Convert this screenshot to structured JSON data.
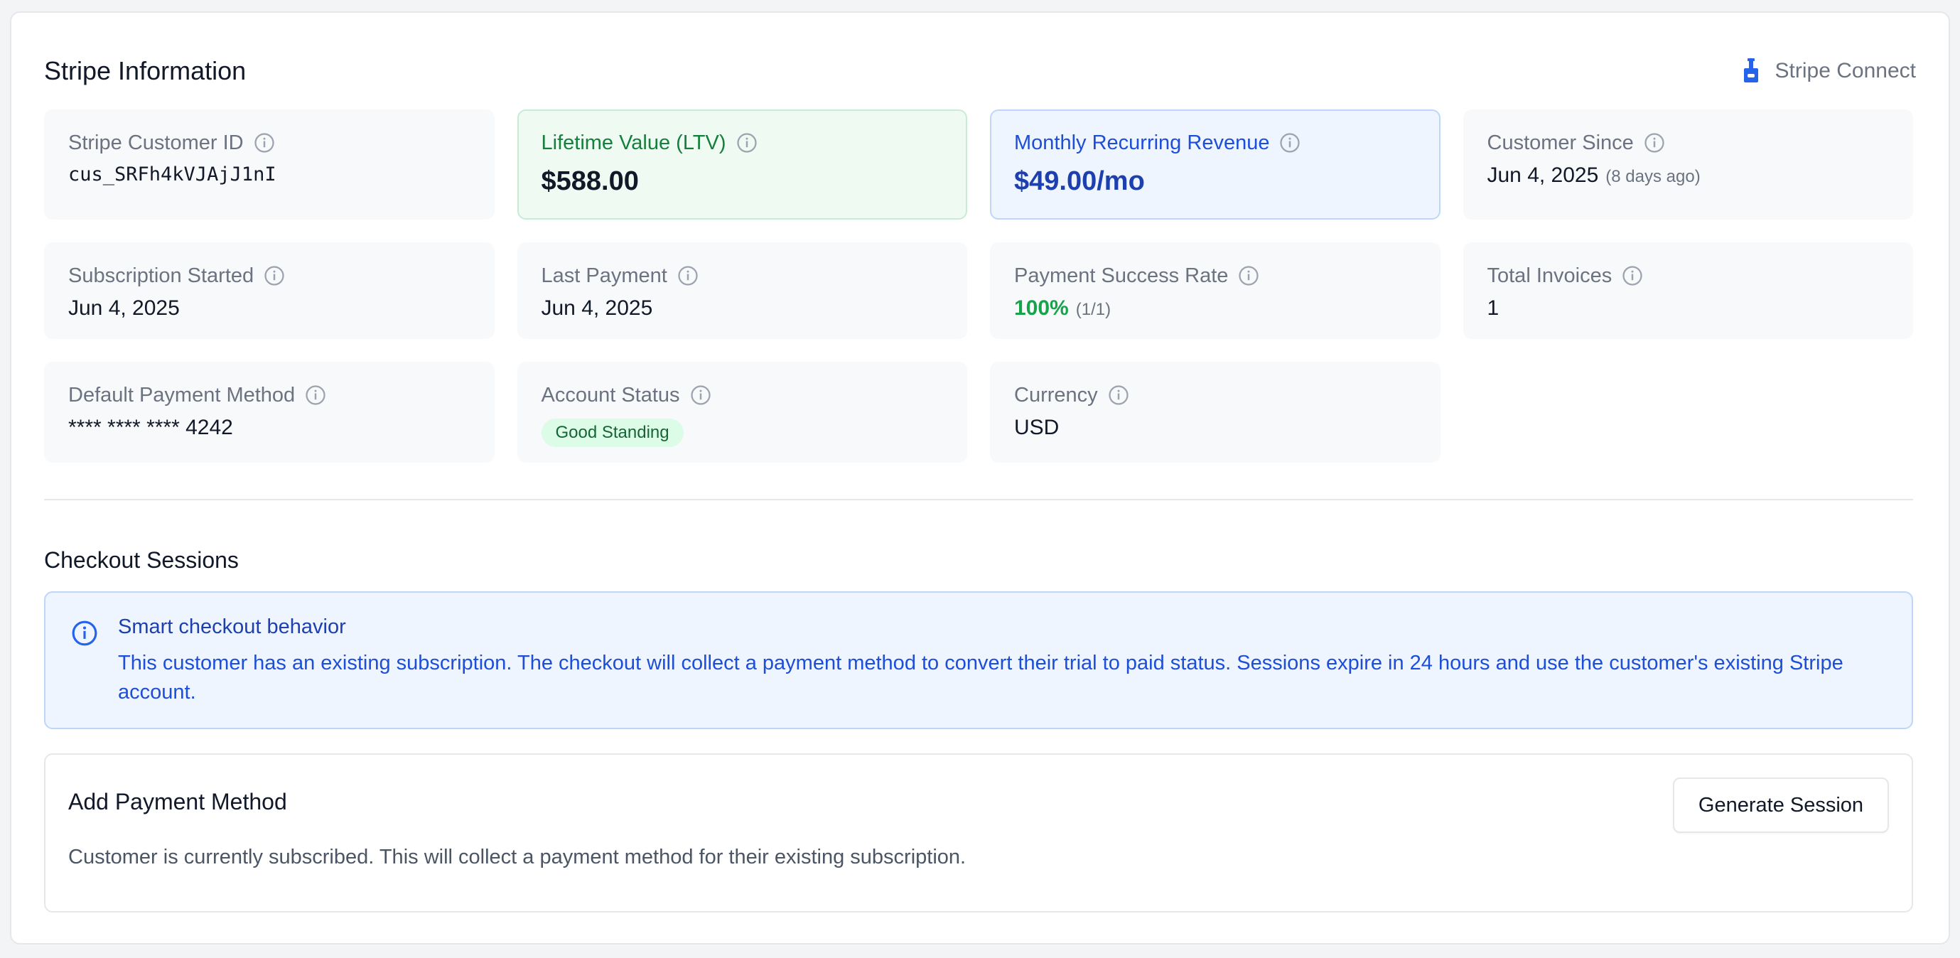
{
  "header": {
    "title": "Stripe Information",
    "connect_label": "Stripe Connect"
  },
  "cards": {
    "customer_id": {
      "label": "Stripe Customer ID",
      "value": "cus_SRFh4kVJAjJ1nI"
    },
    "ltv": {
      "label": "Lifetime Value (LTV)",
      "value": "$588.00"
    },
    "mrr": {
      "label": "Monthly Recurring Revenue",
      "value": "$49.00/mo"
    },
    "customer_since": {
      "label": "Customer Since",
      "value": "Jun 4, 2025",
      "sub": "(8 days ago)"
    },
    "subscription_started": {
      "label": "Subscription Started",
      "value": "Jun 4, 2025"
    },
    "last_payment": {
      "label": "Last Payment",
      "value": "Jun 4, 2025"
    },
    "success_rate": {
      "label": "Payment Success Rate",
      "value": "100%",
      "sub": "(1/1)"
    },
    "total_invoices": {
      "label": "Total Invoices",
      "value": "1"
    },
    "payment_method": {
      "label": "Default Payment Method",
      "value": "**** **** **** 4242"
    },
    "account_status": {
      "label": "Account Status",
      "badge": "Good Standing"
    },
    "currency": {
      "label": "Currency",
      "value": "USD"
    }
  },
  "checkout": {
    "title": "Checkout Sessions",
    "alert_title": "Smart checkout behavior",
    "alert_text": "This customer has an existing subscription. The checkout will collect a payment method to convert their trial to paid status. Sessions expire in 24 hours and use the customer's existing Stripe account.",
    "payment_method": {
      "title": "Add Payment Method",
      "description": "Customer is currently subscribed. This will collect a payment method for their existing subscription.",
      "button_label": "Generate Session"
    }
  },
  "icons": {
    "connect": "stripe-connect-icon",
    "info": "info-circle-icon"
  },
  "colors": {
    "accent_blue": "#1d4ed8",
    "success_green": "#16a34a",
    "ltv_bg": "#effbf2",
    "mrr_bg": "#eef5ff"
  }
}
